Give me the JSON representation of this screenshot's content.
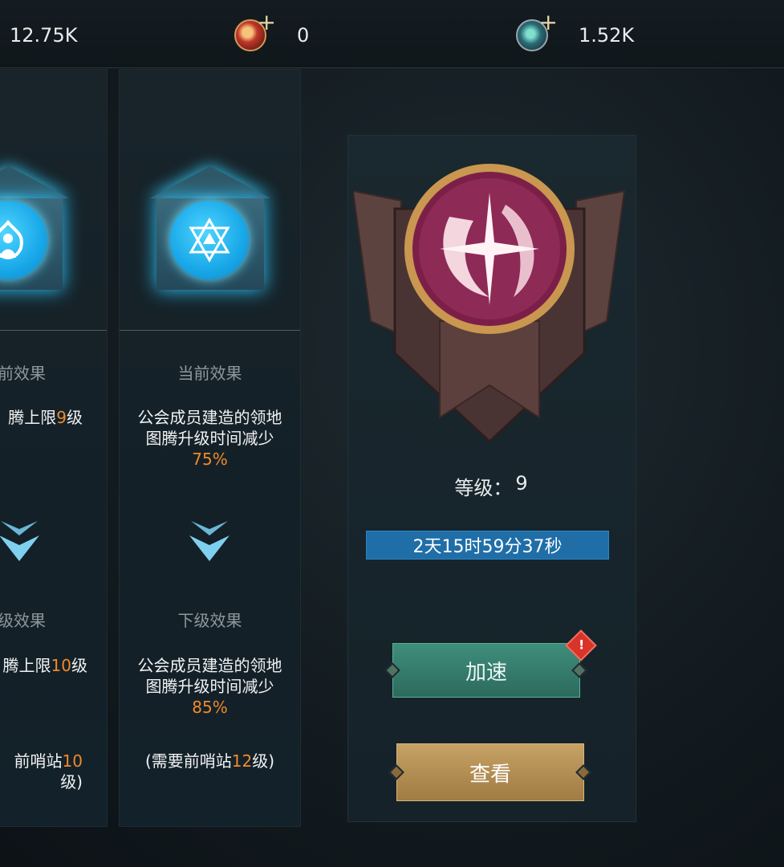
{
  "resources": [
    {
      "icon": "",
      "value": "12.75K"
    },
    {
      "icon": "red-gem-icon",
      "value": "0"
    },
    {
      "icon": "teal-gem-icon",
      "value": "1.52K"
    }
  ],
  "card_left": {
    "current_head": "前效果",
    "current_text_a": "腾上限",
    "current_text_hl": "9",
    "current_text_b": "级",
    "next_head": "级效果",
    "next_text_a": "腾上限",
    "next_text_hl": "10",
    "next_text_b": "级",
    "req_a": "前哨站",
    "req_hl": "10",
    "req_b": "级)"
  },
  "card_middle": {
    "current_head": "当前效果",
    "current_line1": "公会成员建造的领地",
    "current_line2": "图腾升级时间减少",
    "current_pct": "75%",
    "next_head": "下级效果",
    "next_line1": "公会成员建造的领地",
    "next_line2": "图腾升级时间减少",
    "next_pct": "85%",
    "req_a": "(需要前哨站",
    "req_hl": "12",
    "req_b": "级)"
  },
  "panel": {
    "level_label": "等级：",
    "level_value": "9",
    "timer": "2天15时59分37秒",
    "speed_button": "加速",
    "view_button": "查看",
    "badge": "!"
  },
  "colors": {
    "highlight": "#f08a2a",
    "timer_bg": "#1f6ea8",
    "speed_btn": "#3f8e7c",
    "view_btn": "#c7a265"
  }
}
